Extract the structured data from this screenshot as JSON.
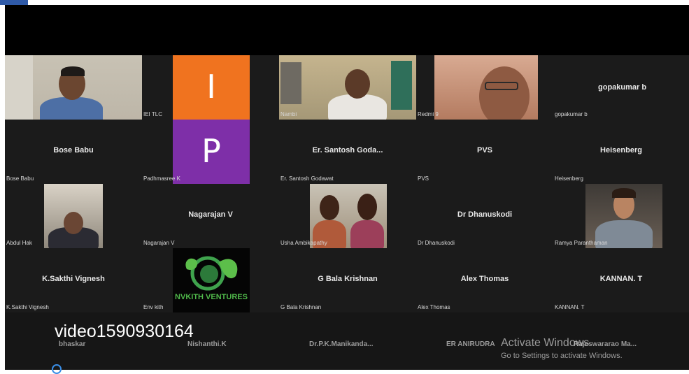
{
  "tiles": {
    "iei_tlc": {
      "label": "IEI TLC"
    },
    "padhmasree_top": {
      "letter": "I",
      "color": "#f0731f"
    },
    "nambi": {
      "label": "Nambi"
    },
    "redmi": {
      "label": "Redmi 9"
    },
    "gopakumar": {
      "name": "gopakumar b",
      "label": "gopakumar b"
    },
    "bose": {
      "name": "Bose Babu",
      "label": "Bose Babu"
    },
    "padhmasree": {
      "letter": "P",
      "color": "#7e2fa8",
      "label": "Padhmasree K"
    },
    "santosh": {
      "name": "Er. Santosh Goda...",
      "label": "Er. Santosh Godawat"
    },
    "pvs": {
      "name": "PVS",
      "label": "PVS"
    },
    "heisenberg": {
      "name": "Heisenberg",
      "label": "Heisenberg"
    },
    "abdul": {
      "label": "Abdul Hak"
    },
    "nagarajan": {
      "name": "Nagarajan V",
      "label": "Nagarajan V"
    },
    "usha": {
      "label": "Usha Ambikapathy"
    },
    "dhanuskodi": {
      "name": "Dr Dhanuskodi",
      "label": "Dr Dhanuskodi"
    },
    "ramya": {
      "label": "Ramya Paranthaman"
    },
    "sakthi": {
      "name": "K.Sakthi Vignesh",
      "label": "K.Sakthi Vignesh"
    },
    "envkith": {
      "logo_text": "NVKITH VENTURES",
      "label": "Env kith"
    },
    "bala": {
      "name": "G Bala Krishnan",
      "label": "G Bala Krishnan"
    },
    "alex": {
      "name": "Alex Thomas",
      "label": "Alex Thomas"
    },
    "kannan": {
      "name": "KANNAN. T",
      "label": "KANNAN. T"
    }
  },
  "bottom_row": {
    "bhaskar": "bhaskar",
    "nishanthi": "Nishanthi.K",
    "manikanda": "Dr.P.K.Manikanda...",
    "anirudra": "ER ANIRUDRA",
    "rajeswararao": "Rajeswararao  Ma..."
  },
  "overlay": {
    "video_id": "video1590930164"
  },
  "watermark": {
    "title": "Activate Windows",
    "subtitle": "Go to Settings to activate Windows."
  }
}
